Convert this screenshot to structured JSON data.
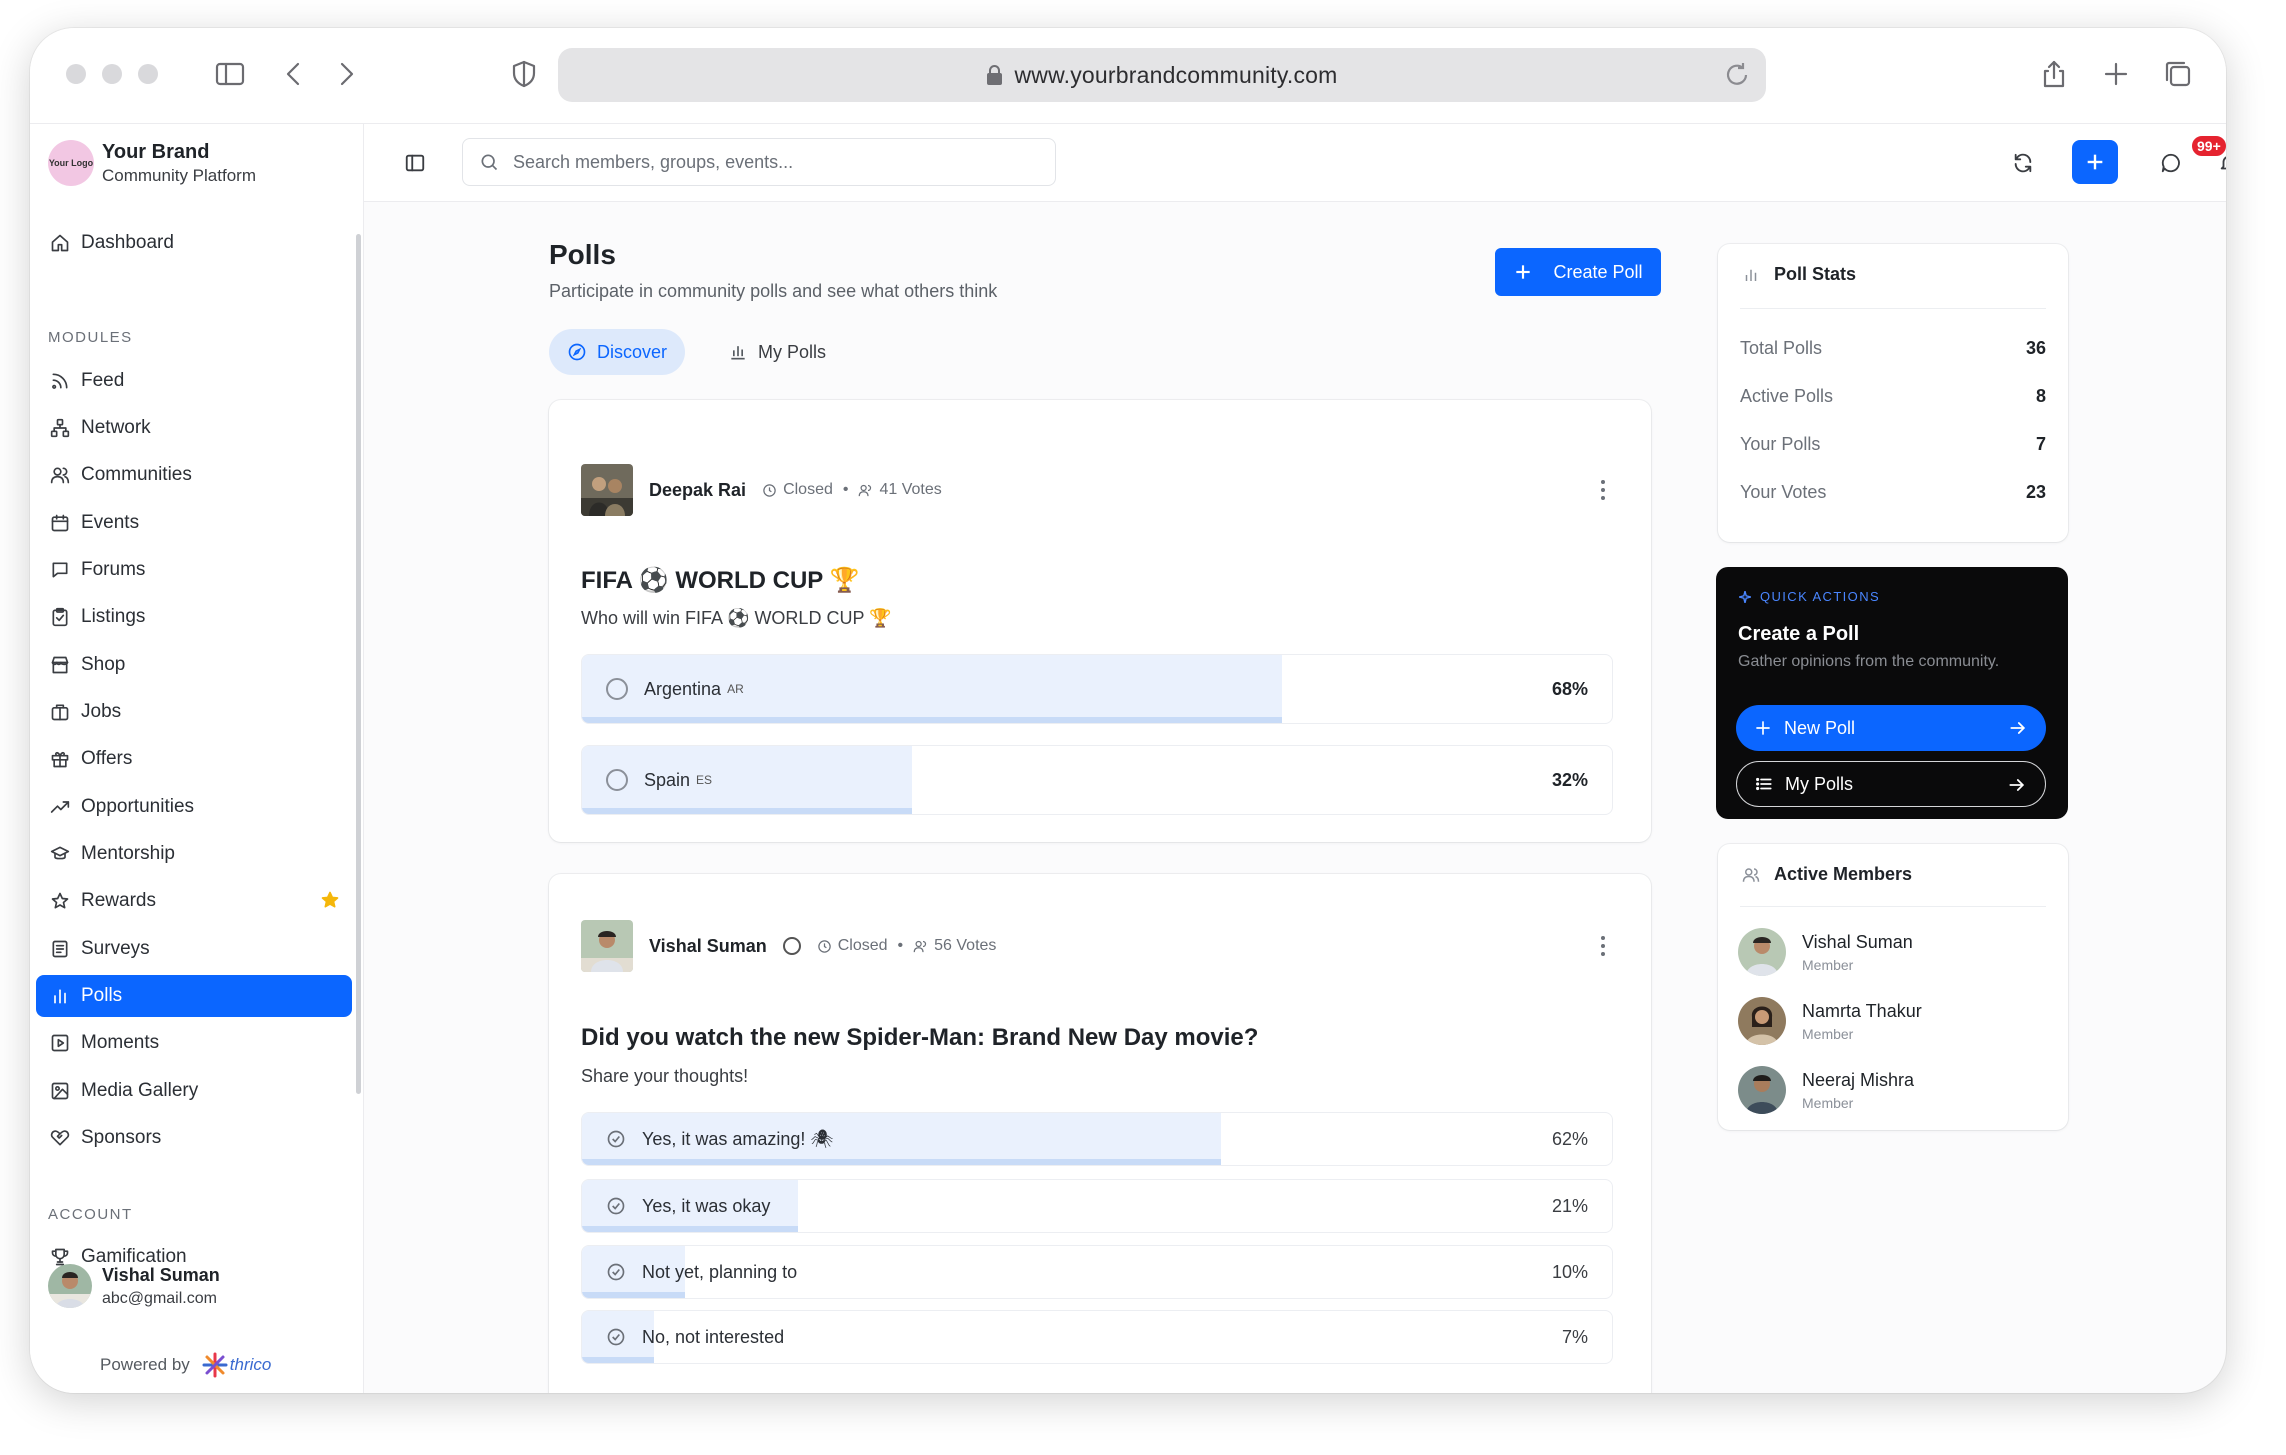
{
  "browser": {
    "url": "www.yourbrandcommunity.com"
  },
  "brand": {
    "logo_text": "Your Logo",
    "name": "Your Brand",
    "subtitle": "Community Platform"
  },
  "sidebar": {
    "dashboard": "Dashboard",
    "modules_label": "MODULES",
    "modules": [
      {
        "label": "Feed",
        "icon": "rss-icon"
      },
      {
        "label": "Network",
        "icon": "network-icon"
      },
      {
        "label": "Communities",
        "icon": "users-icon"
      },
      {
        "label": "Events",
        "icon": "calendar-icon"
      },
      {
        "label": "Forums",
        "icon": "chat-icon"
      },
      {
        "label": "Listings",
        "icon": "clipboard-icon"
      },
      {
        "label": "Shop",
        "icon": "store-icon"
      },
      {
        "label": "Jobs",
        "icon": "briefcase-icon"
      },
      {
        "label": "Offers",
        "icon": "gift-icon"
      },
      {
        "label": "Opportunities",
        "icon": "trending-icon"
      },
      {
        "label": "Mentorship",
        "icon": "graduation-cap-icon"
      },
      {
        "label": "Rewards",
        "icon": "star-icon"
      },
      {
        "label": "Surveys",
        "icon": "survey-icon"
      },
      {
        "label": "Polls",
        "icon": "bar-chart-icon"
      },
      {
        "label": "Moments",
        "icon": "play-icon"
      },
      {
        "label": "Media Gallery",
        "icon": "image-icon"
      },
      {
        "label": "Sponsors",
        "icon": "handshake-icon"
      }
    ],
    "account_label": "ACCOUNT",
    "gamification": "Gamification",
    "user": {
      "name": "Vishal Suman",
      "email": "abc@gmail.com"
    },
    "powered_by": "Powered by",
    "powered_brand": "thrico"
  },
  "topbar": {
    "search_placeholder": "Search members, groups, events...",
    "notification_count": "99+"
  },
  "page": {
    "title": "Polls",
    "subtitle": "Participate in community polls and see what others think",
    "create_button": "Create Poll",
    "tabs": [
      "Discover",
      "My Polls"
    ]
  },
  "polls": [
    {
      "author": "Deepak Rai",
      "status": "Closed",
      "votes": "41 Votes",
      "title": "FIFA ⚽ WORLD CUP 🏆",
      "question": "Who will win FIFA ⚽ WORLD CUP 🏆",
      "options": [
        {
          "label": "Argentina",
          "code": "AR",
          "percent": "68%",
          "value": 0.68
        },
        {
          "label": "Spain",
          "code": "ES",
          "percent": "32%",
          "value": 0.32
        }
      ]
    },
    {
      "author": "Vishal Suman",
      "status": "Closed",
      "votes": "56 Votes",
      "title": "Did you watch the new Spider-Man: Brand New Day movie?",
      "question": "Share your thoughts!",
      "options": [
        {
          "label": "Yes, it was amazing! 🕷",
          "percent": "62%",
          "value": 0.62
        },
        {
          "label": "Yes, it was okay",
          "percent": "21%",
          "value": 0.21
        },
        {
          "label": "Not yet, planning to",
          "percent": "10%",
          "value": 0.1
        },
        {
          "label": "No, not interested",
          "percent": "7%",
          "value": 0.07
        }
      ]
    }
  ],
  "stats": {
    "title": "Poll Stats",
    "rows": [
      {
        "label": "Total Polls",
        "value": "36"
      },
      {
        "label": "Active Polls",
        "value": "8"
      },
      {
        "label": "Your Polls",
        "value": "7"
      },
      {
        "label": "Your Votes",
        "value": "23"
      }
    ]
  },
  "quick_actions": {
    "label": "QUICK ACTIONS",
    "title": "Create a Poll",
    "subtitle": "Gather opinions from the community.",
    "new_poll": "New Poll",
    "my_polls": "My Polls"
  },
  "active_members": {
    "title": "Active Members",
    "members": [
      {
        "name": "Vishal Suman",
        "role": "Member"
      },
      {
        "name": "Namrta Thakur",
        "role": "Member"
      },
      {
        "name": "Neeraj Mishra",
        "role": "Member"
      }
    ]
  },
  "colors": {
    "accent": "#0b66ff",
    "bar_fill": "#eaf1fd",
    "badge": "#e5232f",
    "quick_actions_bg": "#0a0a0b"
  }
}
